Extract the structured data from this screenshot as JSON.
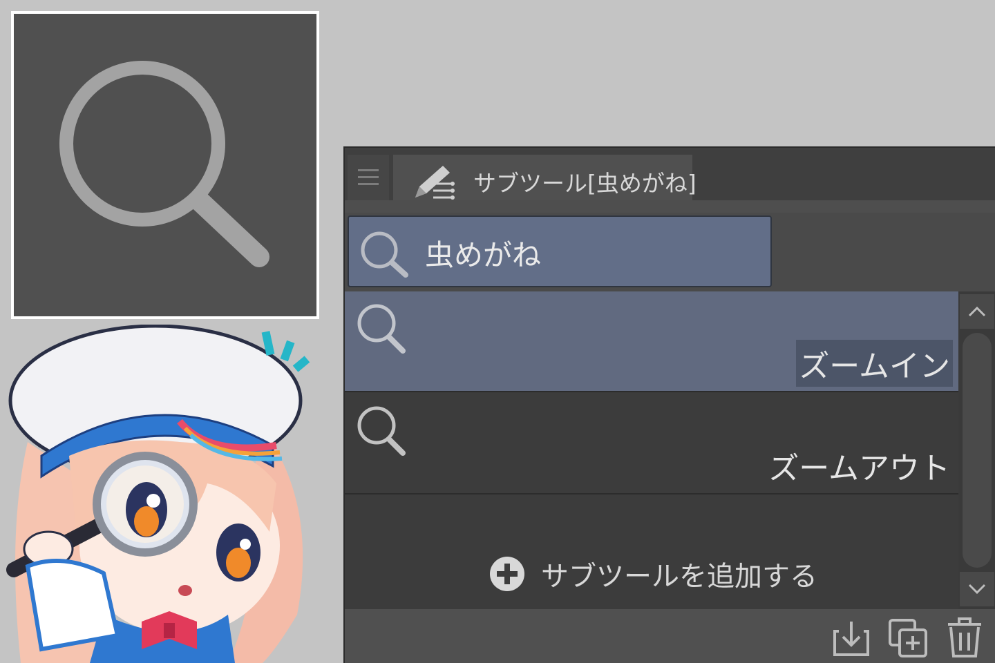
{
  "preview": {
    "icon": "magnifier-icon"
  },
  "panel": {
    "menu_icon": "hamburger-icon",
    "tab": {
      "icon": "pen-tool-icon",
      "label": "サブツール[虫めがね]"
    },
    "search": {
      "icon": "magnifier-icon",
      "value": "虫めがね"
    },
    "items": [
      {
        "icon": "magnifier-icon",
        "label": "ズームイン",
        "selected": true
      },
      {
        "icon": "magnifier-icon",
        "label": "ズームアウト",
        "selected": false
      }
    ],
    "add_label": "サブツールを追加する",
    "scroll": {
      "up_icon": "chevron-up-icon",
      "down_icon": "chevron-down-icon"
    },
    "footer_icons": [
      "import-icon",
      "duplicate-icon",
      "trash-icon"
    ]
  },
  "colors": {
    "background": "#c4c4c4",
    "panel": "#3c3c3c",
    "selection": "#616a80"
  }
}
